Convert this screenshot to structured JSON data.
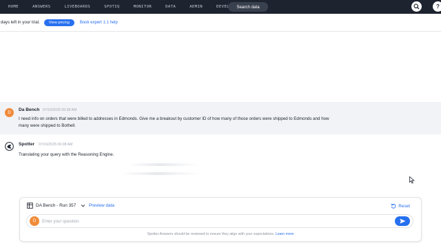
{
  "nav": {
    "items": [
      "HOME",
      "ANSWERS",
      "LIVEBOARDS",
      "SPOTIQ",
      "MONITOR",
      "DATA",
      "ADMIN",
      "DEVELOP"
    ],
    "search_label": "Search data",
    "help_label": "?"
  },
  "banner": {
    "trial_text": "days left in your trial.",
    "pricing_label": "View pricing",
    "expert_label": "Book expert 1:1 help"
  },
  "user_message": {
    "avatar": "D",
    "sender": "Da Bench",
    "timestamp": "07/10/2025 06:08 AM",
    "text": "I need info on orders that were billed to addresses in Edmonds. Give me a breakout by customer ID of how many of those orders were shipped to Edmonds and how many were shipped to Bothell."
  },
  "spotter_message": {
    "sender": "Spotter",
    "timestamp": "07/10/2025 06:08 AM",
    "status": "Translating your query with the Reasoning Engine."
  },
  "composer": {
    "datasource": "DA Bench - Run 357",
    "preview_label": "Preview data",
    "reset_label": "Reset",
    "avatar": "D",
    "placeholder": "Enter your question",
    "disclaimer": "Spotter Answers should be reviewed to ensure they align with your expectations.",
    "learn_more": "Learn more"
  },
  "colors": {
    "nav_bg": "#1d232f",
    "accent": "#2770ef",
    "avatar": "#f08b3b",
    "user_msg_bg": "#f1f3f6"
  }
}
